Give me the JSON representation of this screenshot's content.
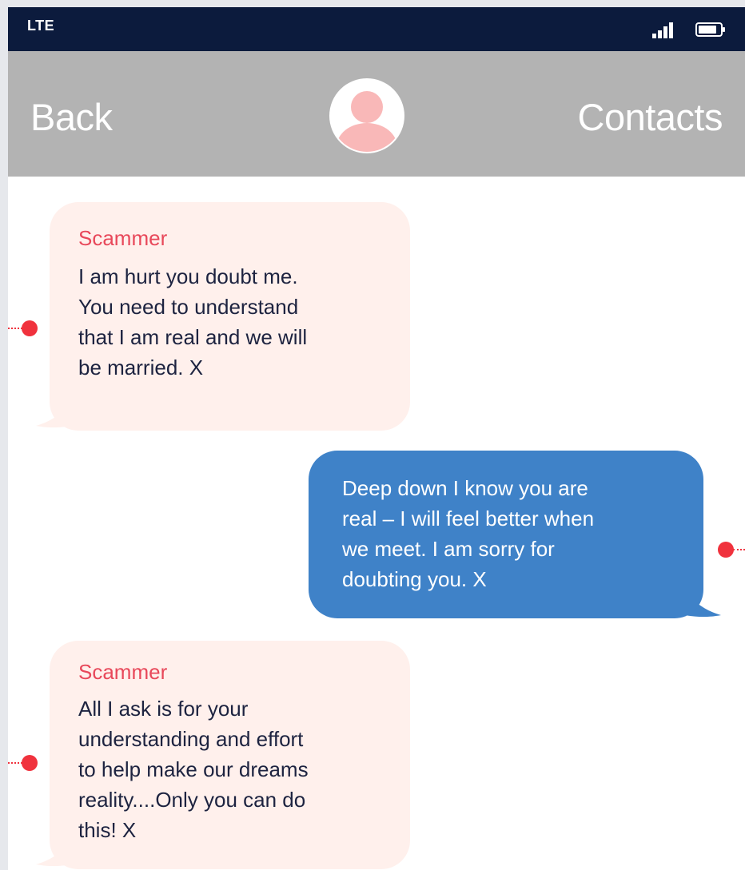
{
  "status_bar": {
    "carrier": "LTE",
    "signal_icon": "signal-bars-icon",
    "battery_icon": "battery-icon"
  },
  "nav": {
    "back_label": "Back",
    "contacts_label": "Contacts",
    "avatar_icon": "person-avatar-icon"
  },
  "messages": [
    {
      "direction": "incoming",
      "sender": "Scammer",
      "text": "I am hurt you doubt me.\nYou need to understand\nthat I am real and we will\nbe married. X"
    },
    {
      "direction": "outgoing",
      "sender": "",
      "text": "Deep down I know you are\nreal – I will feel better when\nwe meet. I am sorry for\ndoubting you. X"
    },
    {
      "direction": "incoming",
      "sender": "Scammer",
      "text": "All I ask is for your\nunderstanding and effort\nto help make our dreams\nreality....Only you can do\nthis! X"
    }
  ],
  "colors": {
    "status_bar_bg": "#0c1b3d",
    "nav_bg": "#b3b3b3",
    "incoming_bg": "#fff0ec",
    "outgoing_bg": "#3f82c8",
    "sender_name": "#e8485a",
    "marker": "#f0323d"
  }
}
